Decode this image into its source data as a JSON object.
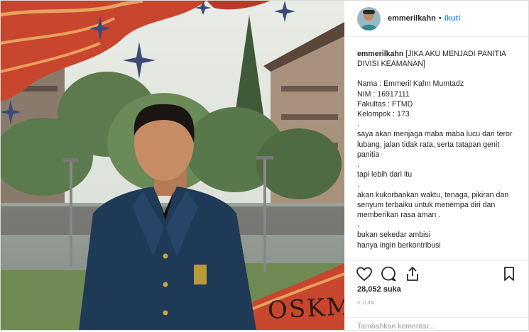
{
  "post": {
    "username": "emmerilkahn",
    "follow_label": "Ikuti",
    "separator": "•",
    "caption_head": "[JIKA AKU MENJADI PANITIA DIVISI KEAMANAN]",
    "caption_lines": [
      "Nama : Emmeril Kahn Mumtadz",
      "NIM : 16917111",
      "Fakultas : FTMD",
      "Kelompok : 173",
      ".",
      "saya akan menjaga maba maba lucu dari teror lubang, jalan tidak rata, serta tatapan genit panitia",
      ".",
      "tapi lebih dari itu",
      ".",
      "akan kukorbankan waktu, tenaga, pikiran dan senyum terbaiku untuk menempa diri dan memberikan rasa aman .",
      ".",
      "bukan sekedar ambisi",
      "hanya ingin berkontribusi"
    ],
    "likes": "28,052 suka",
    "date": "2 JUNI",
    "comment_placeholder": "Tambahkan komentar..."
  },
  "photo": {
    "overlay_text": "OSKM"
  },
  "icons": {
    "like": "heart-icon",
    "comment": "comment-icon",
    "share": "share-icon",
    "save": "bookmark-icon"
  },
  "colors": {
    "link": "#3897f0",
    "text": "#262626",
    "muted": "#999999",
    "jacket": "#1f3a56",
    "banner": "#c8452e"
  }
}
